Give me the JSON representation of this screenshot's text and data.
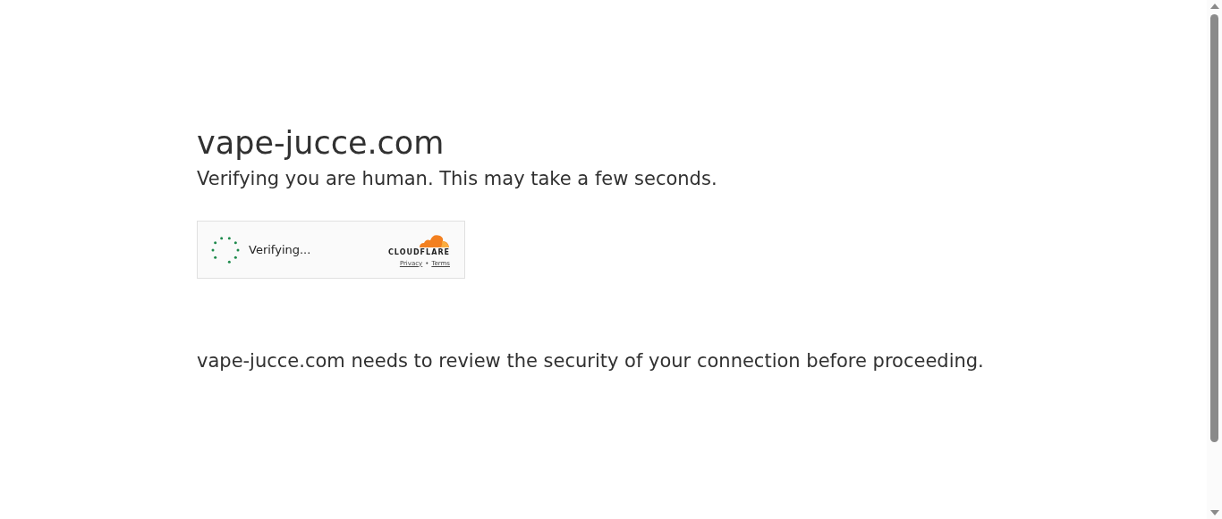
{
  "heading": "vape-jucce.com",
  "subheading": "Verifying you are human. This may take a few seconds.",
  "widget": {
    "status": "Verifying...",
    "brand": "CLOUDFLARE",
    "links": [
      "Privacy",
      "Terms"
    ],
    "separator": "•"
  },
  "message": "vape-jucce.com needs to review the security of your connection before proceeding."
}
